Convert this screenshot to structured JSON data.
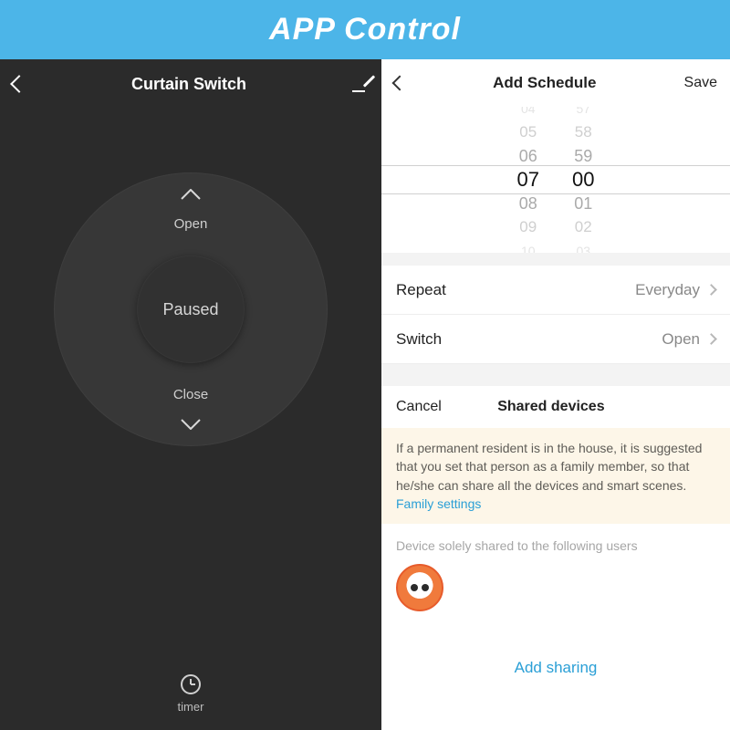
{
  "banner": {
    "title": "APP Control"
  },
  "left": {
    "title": "Curtain Switch",
    "open_label": "Open",
    "close_label": "Close",
    "status": "Paused",
    "timer_label": "timer"
  },
  "right": {
    "title": "Add Schedule",
    "save_label": "Save",
    "picker": {
      "hours": [
        "04",
        "05",
        "06",
        "07",
        "08",
        "09",
        "10"
      ],
      "minutes": [
        "57",
        "58",
        "59",
        "00",
        "01",
        "02",
        "03"
      ],
      "selected_hour": "07",
      "selected_minute": "00"
    },
    "repeat": {
      "label": "Repeat",
      "value": "Everyday"
    },
    "switch": {
      "label": "Switch",
      "value": "Open"
    },
    "shared": {
      "cancel": "Cancel",
      "title": "Shared devices",
      "notice": "If a permanent resident is in the house, it is suggested that you set that person as a family member, so that he/she can share all the devices and smart scenes. ",
      "notice_link": "Family settings",
      "sole_text": "Device solely shared to the following users",
      "add_label": "Add sharing"
    }
  }
}
